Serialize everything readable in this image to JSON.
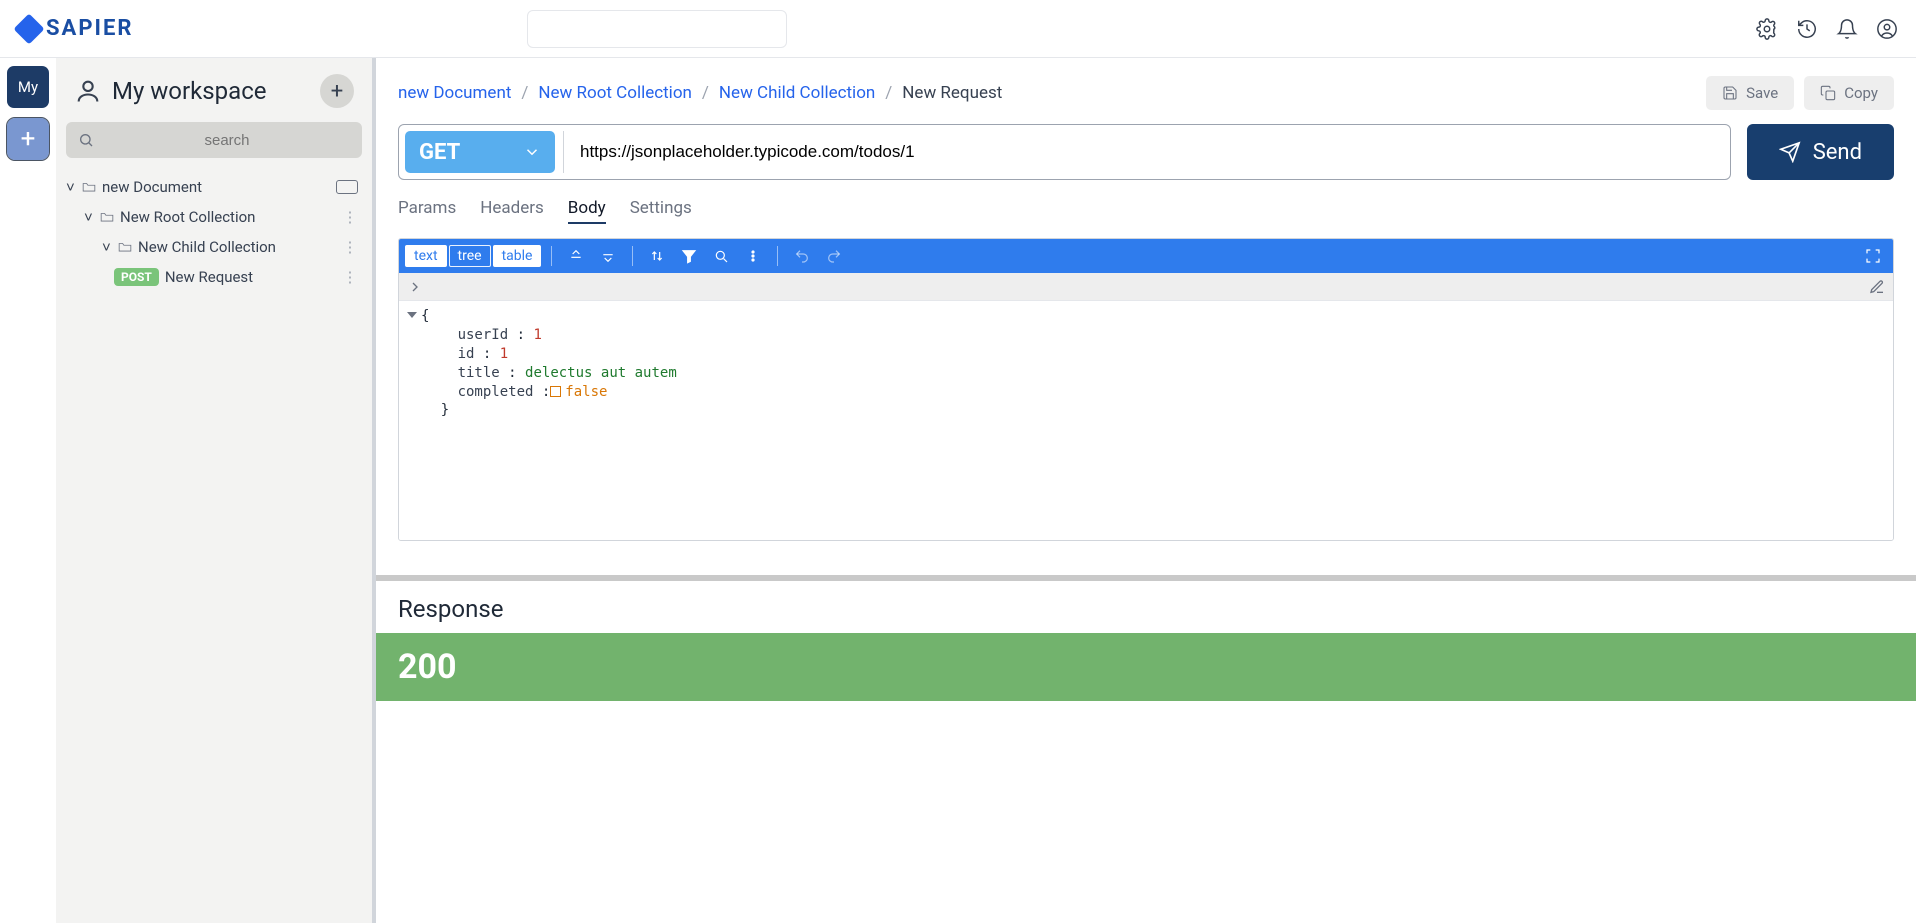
{
  "app": {
    "name": "SAPIER"
  },
  "ws_rail": {
    "active_label": "My"
  },
  "sidebar": {
    "workspace_title": "My workspace",
    "search_placeholder": "search",
    "tree": {
      "doc": "new Document",
      "root": "New Root Collection",
      "child": "New Child Collection",
      "req_method": "POST",
      "req_name": "New Request"
    }
  },
  "breadcrumb": {
    "doc": "new Document",
    "root": "New Root Collection",
    "child": "New Child Collection",
    "current": "New Request"
  },
  "actions": {
    "save": "Save",
    "copy": "Copy"
  },
  "request": {
    "method": "GET",
    "url": "https://jsonplaceholder.typicode.com/todos/1",
    "send_label": "Send"
  },
  "tabs": {
    "params": "Params",
    "headers": "Headers",
    "body": "Body",
    "settings": "Settings",
    "active": "body"
  },
  "editor": {
    "modes": {
      "text": "text",
      "tree": "tree",
      "table": "table",
      "active": "tree"
    },
    "json": {
      "userId_key": "userId",
      "userId_val": "1",
      "id_key": "id",
      "id_val": "1",
      "title_key": "title",
      "title_val": "delectus aut autem",
      "completed_key": "completed",
      "completed_val": "false"
    }
  },
  "response": {
    "title": "Response",
    "status_code": "200"
  }
}
